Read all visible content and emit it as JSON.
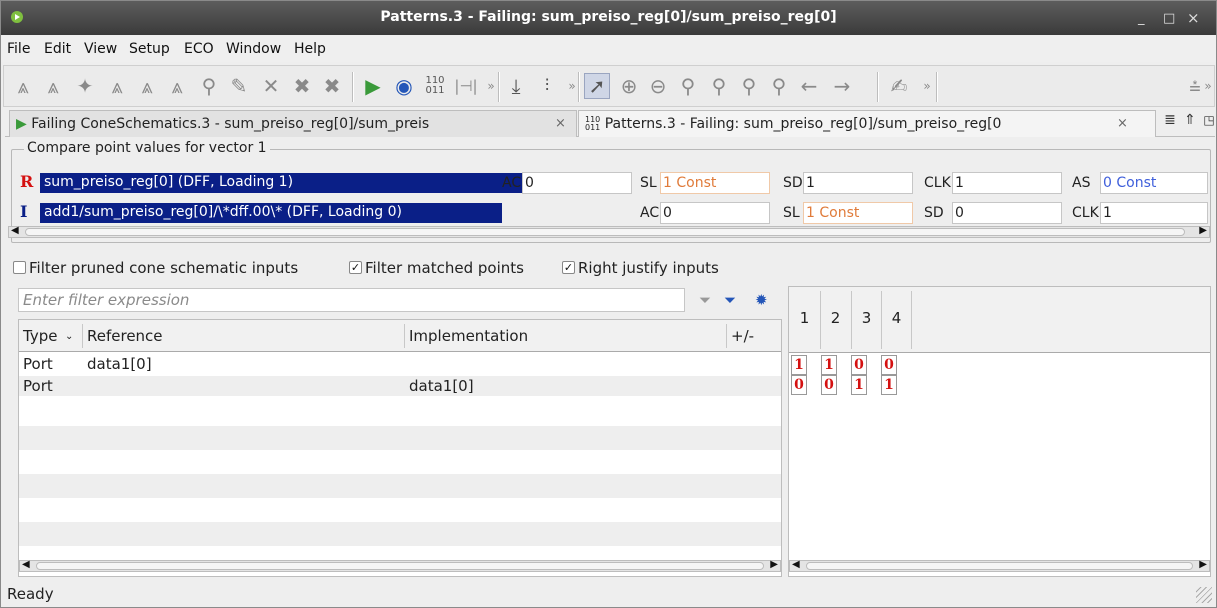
{
  "window": {
    "title": "Patterns.3 - Failing: sum_preiso_reg[0]/sum_preiso_reg[0]",
    "minimize": "_",
    "maximize": "□",
    "close": "×"
  },
  "menu": [
    "File",
    "Edit",
    "View",
    "Setup",
    "ECO",
    "Window",
    "Help"
  ],
  "tabs": [
    {
      "label": "Failing ConeSchematics.3 - sum_preiso_reg[0]/sum_preis",
      "close": "×"
    },
    {
      "label": "Patterns.3 - Failing: sum_preiso_reg[0]/sum_preiso_reg[0",
      "close": "×",
      "icon_text": "110\n011"
    }
  ],
  "compare": {
    "legend": "Compare point values for vector 1",
    "ref": {
      "badge": "R",
      "signal": "sum_preiso_reg[0] (DFF, Loading 1)",
      "fields": [
        {
          "label": "AC",
          "value": "0"
        },
        {
          "label": "SL",
          "value": "1 Const"
        },
        {
          "label": "SD",
          "value": "1"
        },
        {
          "label": "CLK",
          "value": "1"
        },
        {
          "label": "AS",
          "value": "0 Const"
        }
      ]
    },
    "impl": {
      "badge": "I",
      "signal": "add1/sum_preiso_reg[0]/\\*dff.00\\* (DFF, Loading 0)",
      "fields": [
        {
          "label": "AC",
          "value": "0"
        },
        {
          "label": "SL",
          "value": "1 Const"
        },
        {
          "label": "SD",
          "value": "0"
        },
        {
          "label": "CLK",
          "value": "1"
        }
      ]
    }
  },
  "filters": {
    "pruned": {
      "label": "Filter pruned cone schematic inputs",
      "checked": false
    },
    "matched": {
      "label": "Filter matched points",
      "checked": true
    },
    "justify": {
      "label": "Right justify inputs",
      "checked": true
    }
  },
  "filter_input": {
    "placeholder": "Enter filter expression"
  },
  "table": {
    "headers": {
      "type": "Type",
      "reference": "Reference",
      "implementation": "Implementation",
      "plusminus": "+/-"
    },
    "rows": [
      {
        "type": "Port",
        "reference": "data1[0]",
        "implementation": ""
      },
      {
        "type": "Port",
        "reference": "",
        "implementation": "data1[0]"
      }
    ]
  },
  "vectors": {
    "columns": [
      "1",
      "2",
      "3",
      "4"
    ],
    "rows": [
      [
        "1",
        "1",
        "0",
        "0"
      ],
      [
        "0",
        "0",
        "1",
        "1"
      ]
    ]
  },
  "status": "Ready",
  "colors": {
    "titlebar": "#3a3a3a",
    "signal_bg": "#0a1f87",
    "const_text": "#e07b3a",
    "vector_text": "#d41010",
    "blue_text": "#3f5fdb"
  },
  "icons": [
    "app-icon",
    "find-icon",
    "binoculars-icon",
    "highlight-icon",
    "cross-icon",
    "run-icon",
    "zoom-icon",
    "binary-icon",
    "sort-icon",
    "select-arrow-icon",
    "zoom-in-icon",
    "zoom-out-icon",
    "back-icon",
    "forward-icon",
    "pin-icon",
    "filter-icon",
    "gear-icon"
  ]
}
